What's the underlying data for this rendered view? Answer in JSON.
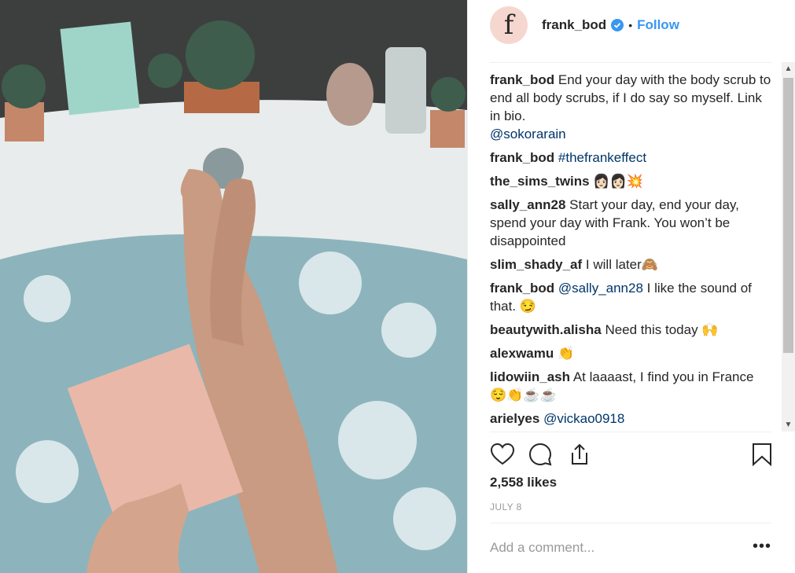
{
  "post": {
    "username": "frank_bod",
    "avatar_letter": "f",
    "follow_label": "Follow",
    "separator": "•",
    "likes": "2,558 likes",
    "date": "JULY 8",
    "add_comment_placeholder": "Add a comment...",
    "more_label": "•••"
  },
  "comments": [
    {
      "user": "frank_bod",
      "text": "End your day with the body scrub to end all body scrubs, if I do say so myself. Link in bio.",
      "mention": "@sokorarain"
    },
    {
      "user": "frank_bod",
      "text": "",
      "mention": "#thefrankeffect"
    },
    {
      "user": "the_sims_twins",
      "text": "👩🏻👩🏻💥",
      "mention": ""
    },
    {
      "user": "sally_ann28",
      "text": "Start your day, end your day, spend your day with Frank. You won’t be disappointed",
      "mention": ""
    },
    {
      "user": "slim_shady_af",
      "text": "I will later🙈",
      "mention": ""
    },
    {
      "user": "frank_bod",
      "text": "I like the sound of that. 😏",
      "mention": "@sally_ann28"
    },
    {
      "user": "beautywith.alisha",
      "text": "Need this today 🙌",
      "mention": ""
    },
    {
      "user": "alexwamu",
      "text": "👏",
      "mention": ""
    },
    {
      "user": "lidowiin_ash",
      "text": "At laaaast, I find you in France 😌👏☕☕",
      "mention": ""
    },
    {
      "user": "arielyes",
      "text": "",
      "mention": "@vickao0918"
    }
  ],
  "icons": {
    "like": "heart-icon",
    "comment": "comment-icon",
    "share": "share-icon",
    "save": "bookmark-icon",
    "verified": "verified-badge-icon"
  },
  "colors": {
    "follow": "#3897f0",
    "link": "#003569",
    "muted": "#999999",
    "avatar_bg": "#f6d7cf"
  }
}
